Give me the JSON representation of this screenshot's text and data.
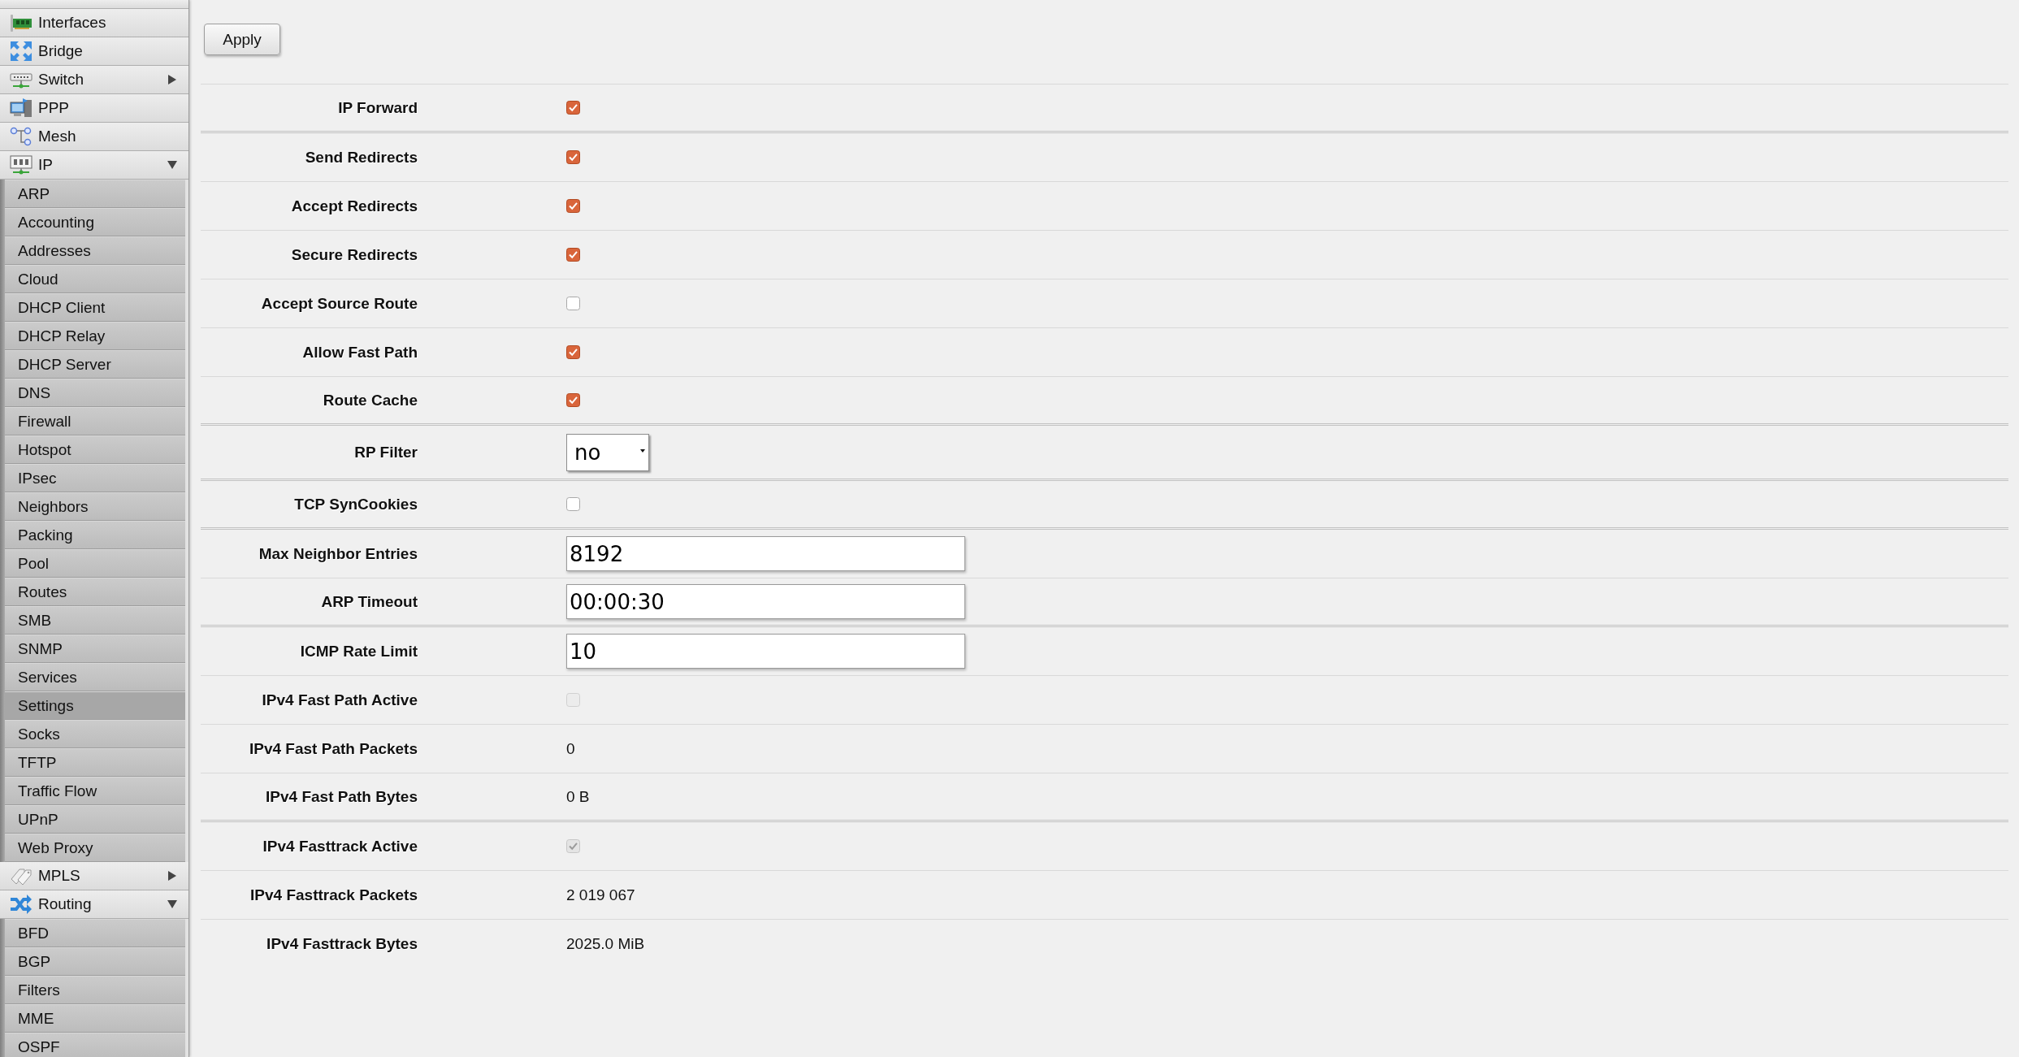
{
  "sidebar": {
    "items": [
      {
        "label": "Interfaces",
        "kind": "link",
        "selected": false
      },
      {
        "label": "Bridge",
        "kind": "link",
        "selected": false
      },
      {
        "label": "Switch",
        "kind": "menu",
        "expanded": false,
        "selected": false
      },
      {
        "label": "PPP",
        "kind": "link",
        "selected": false
      },
      {
        "label": "Mesh",
        "kind": "link",
        "selected": false
      },
      {
        "label": "IP",
        "kind": "menu",
        "expanded": true,
        "selected": false,
        "children": [
          {
            "label": "ARP",
            "selected": false
          },
          {
            "label": "Accounting",
            "selected": false
          },
          {
            "label": "Addresses",
            "selected": false
          },
          {
            "label": "Cloud",
            "selected": false
          },
          {
            "label": "DHCP Client",
            "selected": false
          },
          {
            "label": "DHCP Relay",
            "selected": false
          },
          {
            "label": "DHCP Server",
            "selected": false
          },
          {
            "label": "DNS",
            "selected": false
          },
          {
            "label": "Firewall",
            "selected": false
          },
          {
            "label": "Hotspot",
            "selected": false
          },
          {
            "label": "IPsec",
            "selected": false
          },
          {
            "label": "Neighbors",
            "selected": false
          },
          {
            "label": "Packing",
            "selected": false
          },
          {
            "label": "Pool",
            "selected": false
          },
          {
            "label": "Routes",
            "selected": false
          },
          {
            "label": "SMB",
            "selected": false
          },
          {
            "label": "SNMP",
            "selected": false
          },
          {
            "label": "Services",
            "selected": false
          },
          {
            "label": "Settings",
            "selected": true
          },
          {
            "label": "Socks",
            "selected": false
          },
          {
            "label": "TFTP",
            "selected": false
          },
          {
            "label": "Traffic Flow",
            "selected": false
          },
          {
            "label": "UPnP",
            "selected": false
          },
          {
            "label": "Web Proxy",
            "selected": false
          }
        ]
      },
      {
        "label": "MPLS",
        "kind": "menu",
        "expanded": false,
        "selected": false
      },
      {
        "label": "Routing",
        "kind": "menu",
        "expanded": true,
        "selected": false,
        "children": [
          {
            "label": "BFD",
            "selected": false
          },
          {
            "label": "BGP",
            "selected": false
          },
          {
            "label": "Filters",
            "selected": false
          },
          {
            "label": "MME",
            "selected": false
          },
          {
            "label": "OSPF",
            "selected": false
          }
        ]
      }
    ]
  },
  "apply_button": {
    "label": "Apply"
  },
  "sections": [
    {
      "fields": [
        {
          "label": "IP Forward",
          "kind": "checkbox",
          "checked": true,
          "disabled": false
        }
      ]
    },
    {
      "fields": [
        {
          "label": "Send Redirects",
          "kind": "checkbox",
          "checked": true,
          "disabled": false
        },
        {
          "label": "Accept Redirects",
          "kind": "checkbox",
          "checked": true,
          "disabled": false
        },
        {
          "label": "Secure Redirects",
          "kind": "checkbox",
          "checked": true,
          "disabled": false
        },
        {
          "label": "Accept Source Route",
          "kind": "checkbox",
          "checked": false,
          "disabled": false
        },
        {
          "label": "Allow Fast Path",
          "kind": "checkbox",
          "checked": true,
          "disabled": false
        },
        {
          "label": "Route Cache",
          "kind": "checkbox",
          "checked": true,
          "disabled": false
        }
      ]
    },
    {
      "fields": [
        {
          "label": "RP Filter",
          "kind": "select",
          "value": "no"
        }
      ]
    },
    {
      "fields": [
        {
          "label": "TCP SynCookies",
          "kind": "checkbox",
          "checked": false,
          "disabled": false
        }
      ]
    },
    {
      "fields": [
        {
          "label": "Max Neighbor Entries",
          "kind": "text",
          "value": "8192"
        },
        {
          "label": "ARP Timeout",
          "kind": "text",
          "value": "00:00:30"
        }
      ]
    },
    {
      "fields": [
        {
          "label": "ICMP Rate Limit",
          "kind": "text",
          "value": "10"
        },
        {
          "label": "IPv4 Fast Path Active",
          "kind": "checkbox",
          "checked": false,
          "disabled": true
        },
        {
          "label": "IPv4 Fast Path Packets",
          "kind": "value",
          "value": "0"
        },
        {
          "label": "IPv4 Fast Path Bytes",
          "kind": "value",
          "value": "0 B"
        }
      ]
    },
    {
      "fields": [
        {
          "label": "IPv4 Fasttrack Active",
          "kind": "checkbox",
          "checked": true,
          "disabled": true
        },
        {
          "label": "IPv4 Fasttrack Packets",
          "kind": "value",
          "value": "2 019 067"
        },
        {
          "label": "IPv4 Fasttrack Bytes",
          "kind": "value",
          "value": "2025.0 MiB"
        }
      ]
    }
  ]
}
